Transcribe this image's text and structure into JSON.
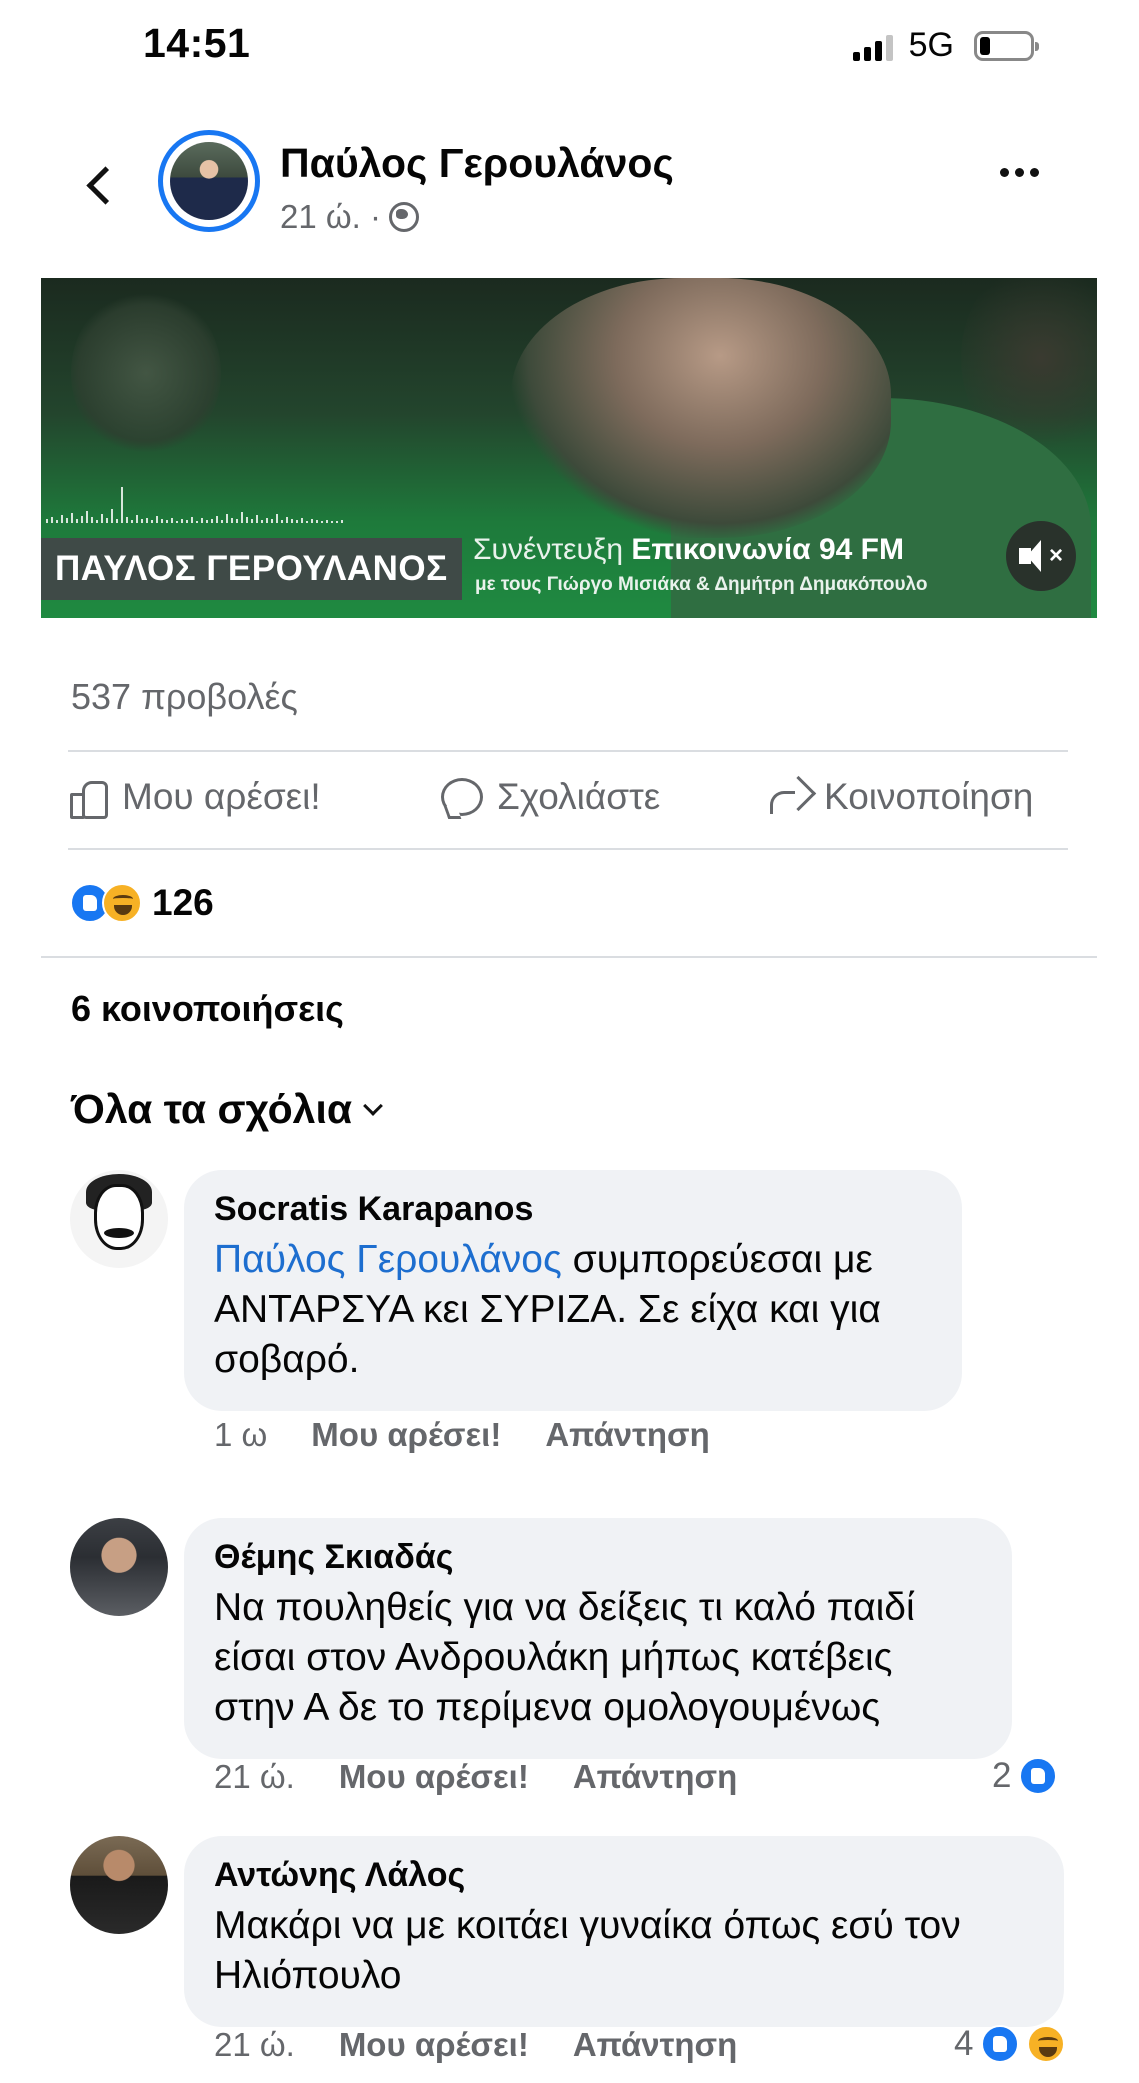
{
  "status_bar": {
    "time": "14:51",
    "network": "5G"
  },
  "post": {
    "author": "Παύλος Γερουλάνος",
    "time": "21 ώ. ·",
    "video": {
      "name_tag": "ΠΑΥΛΟΣ ΓΕΡΟΥΛΑΝΟΣ",
      "line1_prefix": "Συνέντευξη",
      "line1_station": "Επικοινωνία 94 FM",
      "line2": "με τους Γιώργο Μισιάκα & Δημήτρη Δημακόπουλο"
    },
    "views": "537 προβολές",
    "actions": {
      "like": "Μου αρέσει!",
      "comment": "Σχολιάστε",
      "share": "Κοινοποίηση"
    },
    "reaction_count": "126",
    "shares": "6 κοινοποιήσεις",
    "comments_filter": "Όλα τα σχόλια"
  },
  "comments": [
    {
      "name": "Socratis Karapanos",
      "mention": "Παύλος Γερουλάνος",
      "text_line1_rest": " συμπορεύεσαι με",
      "text_line2": "ΑΝΤΑΡΣΥΑ κει ΣΥΡΙΖΑ. Σε είχα και για",
      "text_line3": "σοβαρό.",
      "time": "1 ω",
      "like": "Μου αρέσει!",
      "reply": "Απάντηση"
    },
    {
      "name": "Θέμης Σκιαδάς",
      "text_line1": "Να πουληθείς για να δείξεις τι καλό παιδί",
      "text_line2": "είσαι στον Ανδρουλάκη μήπως κατέβεις",
      "text_line3": "στην Α δε το περίμενα ομολογουμένως",
      "time": "21 ώ.",
      "like": "Μου αρέσει!",
      "reply": "Απάντηση",
      "reactions": "2"
    },
    {
      "name": "Αντώνης Λάλος",
      "text_line1": "Μακάρι να με κοιτάει γυναίκα όπως εσύ τον",
      "text_line2": "Ηλιόπουλο",
      "time": "21 ώ.",
      "like": "Μου αρέσει!",
      "reply": "Απάντηση",
      "reactions": "4"
    }
  ],
  "colors": {
    "accent": "#1877f2",
    "mention": "#1d6ecf",
    "muted": "#65676b",
    "bubble": "#f0f2f5",
    "video_green": "#1f8a41"
  }
}
